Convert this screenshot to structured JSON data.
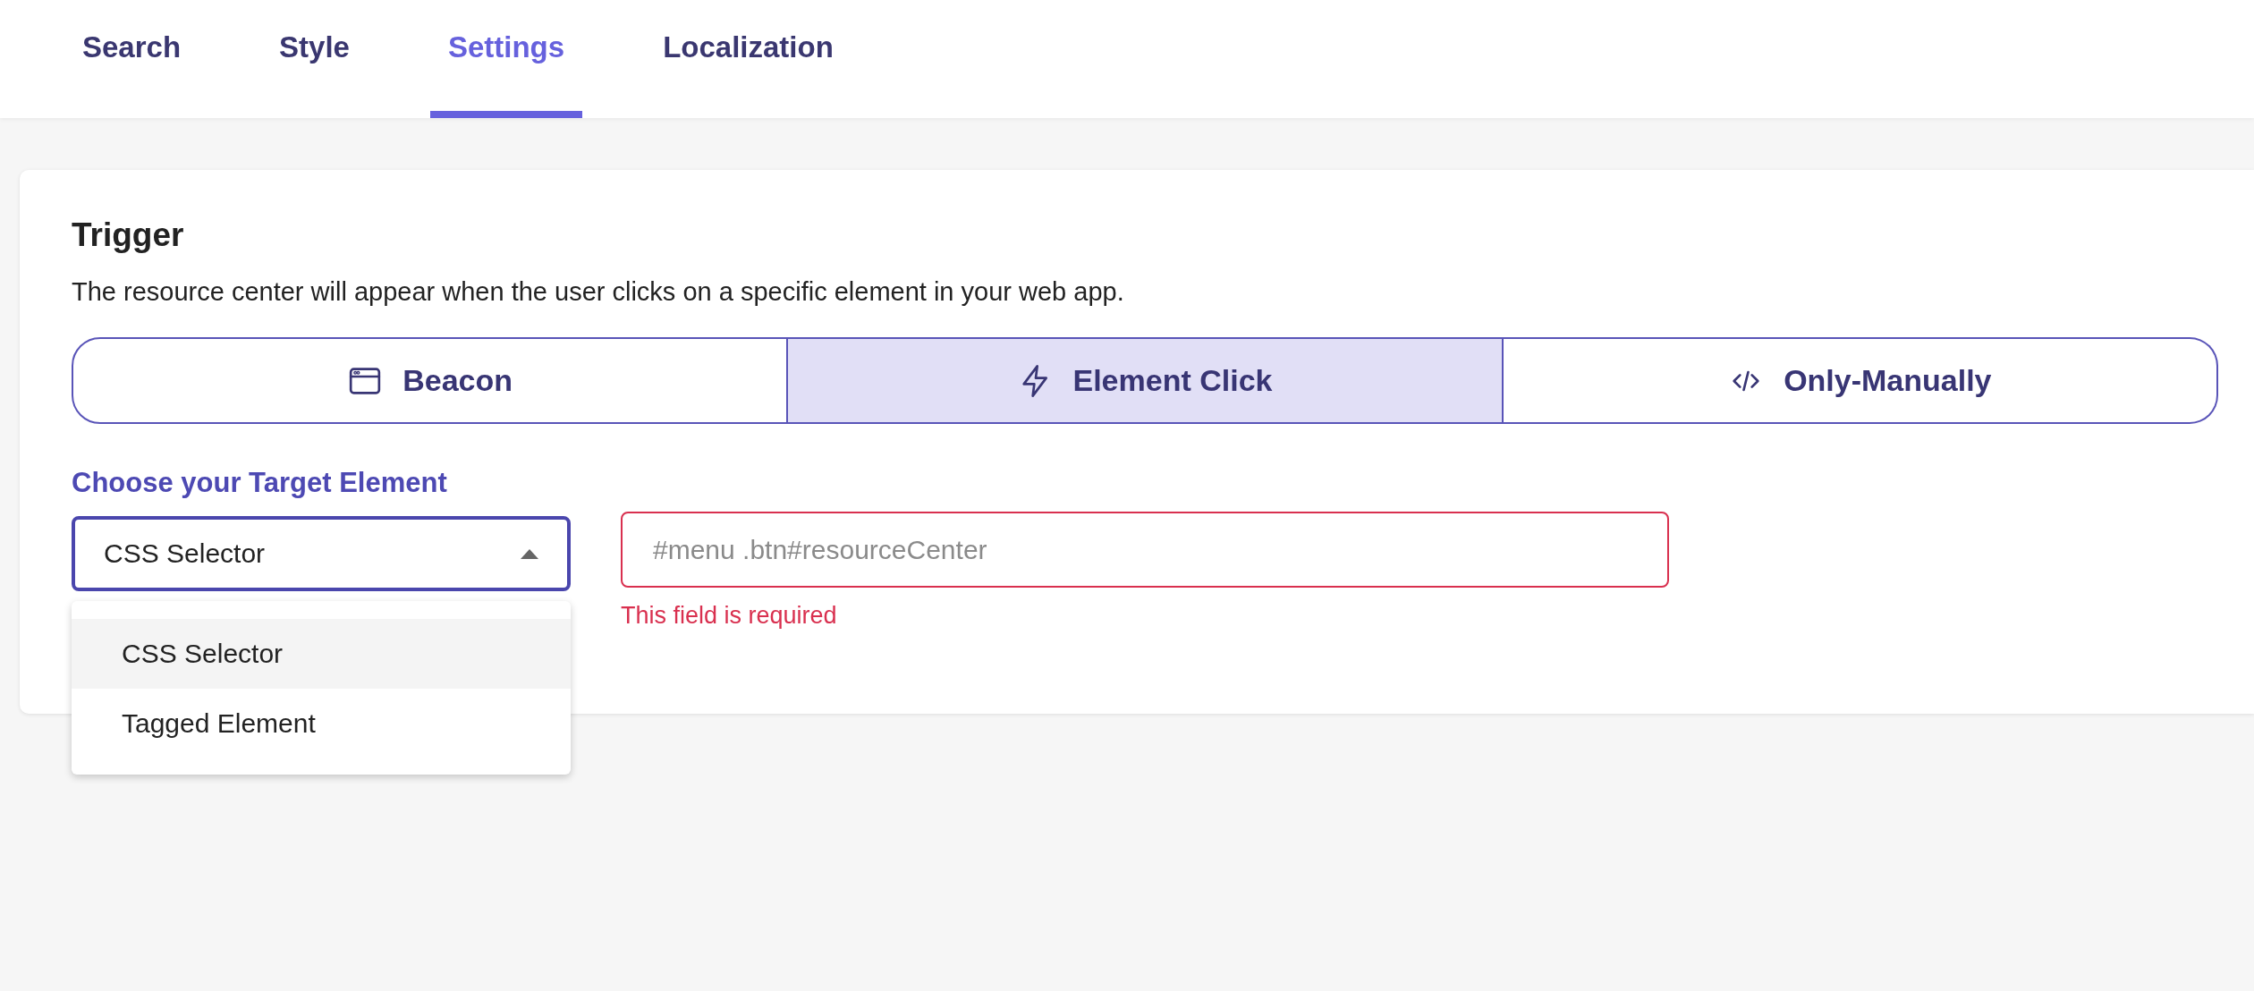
{
  "tabs": [
    {
      "label": "Search",
      "selected": false
    },
    {
      "label": "Style",
      "selected": false
    },
    {
      "label": "Settings",
      "selected": true
    },
    {
      "label": "Localization",
      "selected": false
    }
  ],
  "trigger": {
    "title": "Trigger",
    "description": "The resource center will appear when the user clicks on a specific element in your web app.",
    "options": [
      {
        "label": "Beacon",
        "kind": "window",
        "selected": false
      },
      {
        "label": "Element Click",
        "kind": "bolt",
        "selected": true
      },
      {
        "label": "Only-Manually",
        "kind": "code",
        "selected": false
      }
    ]
  },
  "target": {
    "label": "Choose your Target Element",
    "select": {
      "value": "CSS Selector",
      "expanded": true
    },
    "options": [
      {
        "label": "CSS Selector",
        "highlighted": true
      },
      {
        "label": "Tagged Element",
        "highlighted": false
      }
    ],
    "input": {
      "placeholder": "#menu .btn#resourceCenter",
      "error": "This field is required"
    }
  }
}
